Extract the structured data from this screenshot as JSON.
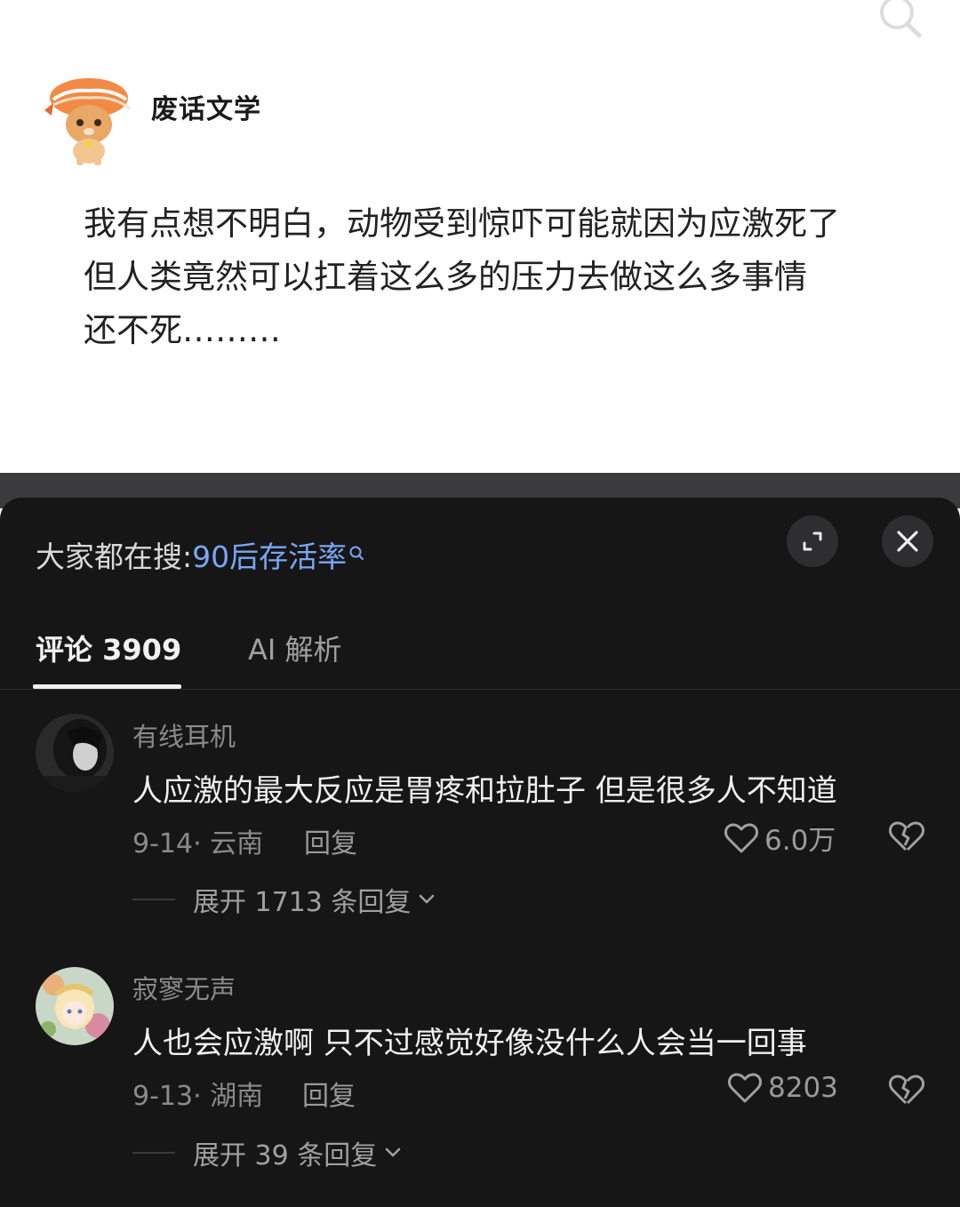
{
  "post": {
    "author": "废话文学",
    "lines": [
      "我有点想不明白，动物受到惊吓可能就因为应激死了",
      "但人类竟然可以扛着这么多的压力去做这么多事情",
      "还不死………"
    ]
  },
  "hot_search": {
    "prefix": "大家都在搜:",
    "keyword": "90后存活率"
  },
  "tabs": {
    "comments": "评论 3909",
    "ai": "AI 解析"
  },
  "comments": [
    {
      "user": "有线耳机",
      "text": "人应激的最大反应是胃疼和拉肚子 但是很多人不知道",
      "date": "9-14· 云南",
      "reply": "回复",
      "likes": "6.0万",
      "expand": "展开 1713 条回复"
    },
    {
      "user": "寂寥无声",
      "text": "人也会应激啊 只不过感觉好像没什么人会当一回事",
      "date": "9-13· 湖南",
      "reply": "回复",
      "likes": "8203",
      "expand": "展开 39 条回复"
    }
  ],
  "colors": {
    "sheet_bg": "#161616",
    "keyword": "#7aa7f7"
  }
}
